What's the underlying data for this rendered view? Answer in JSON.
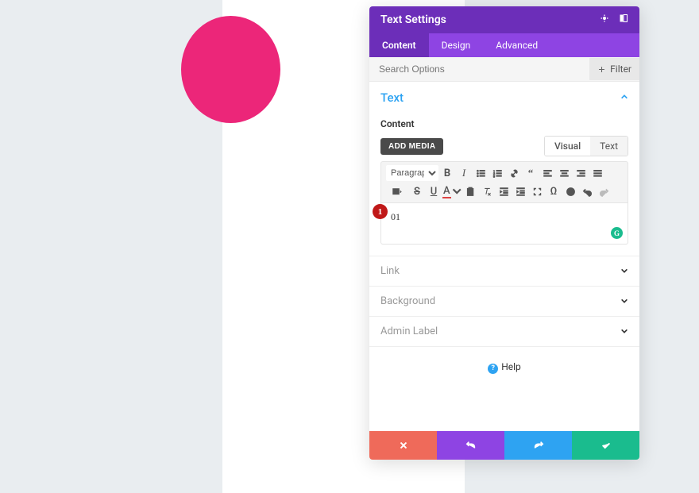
{
  "panel": {
    "title": "Text Settings",
    "tabs": {
      "content": "Content",
      "design": "Design",
      "advanced": "Advanced"
    },
    "search_placeholder": "Search Options",
    "filter_label": "Filter"
  },
  "sections": {
    "text": {
      "title": "Text"
    },
    "link": {
      "title": "Link"
    },
    "background": {
      "title": "Background"
    },
    "admin_label": {
      "title": "Admin Label"
    }
  },
  "text_section": {
    "content_label": "Content",
    "add_media": "ADD MEDIA",
    "visual_tab": "Visual",
    "text_tab": "Text",
    "format_select": "Paragraph",
    "editor_value": "01"
  },
  "step_badge": "1",
  "grammarly": "G",
  "help": {
    "label": "Help"
  }
}
